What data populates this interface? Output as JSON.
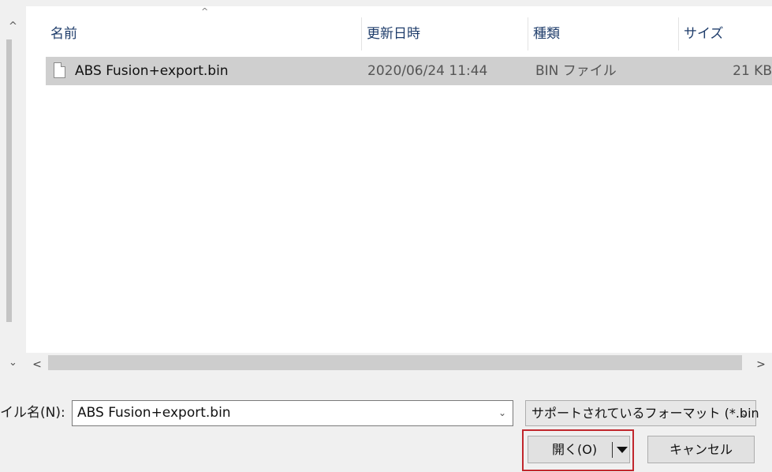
{
  "nav_pane": {
    "scroll_up_icon": "chevron-up-icon",
    "scroll_down_icon": "chevron-down-icon"
  },
  "file_list": {
    "sort_indicator": "^",
    "columns": {
      "name": "名前",
      "date": "更新日時",
      "type": "種類",
      "size": "サイズ"
    },
    "rows": [
      {
        "name": "ABS Fusion+export.bin",
        "date": "2020/06/24 11:44",
        "type": "BIN ファイル",
        "size": "21 KB",
        "selected": true
      }
    ],
    "hscroll_left": "<",
    "hscroll_right": ">"
  },
  "footer": {
    "filename_label": "イル名(N):",
    "filename_value": "ABS Fusion+export.bin",
    "filter_value": "サポートされているフォーマット (*.bin",
    "open_label": "開く(O)",
    "cancel_label": "キャンセル",
    "highlight_color": "#c1272d"
  }
}
